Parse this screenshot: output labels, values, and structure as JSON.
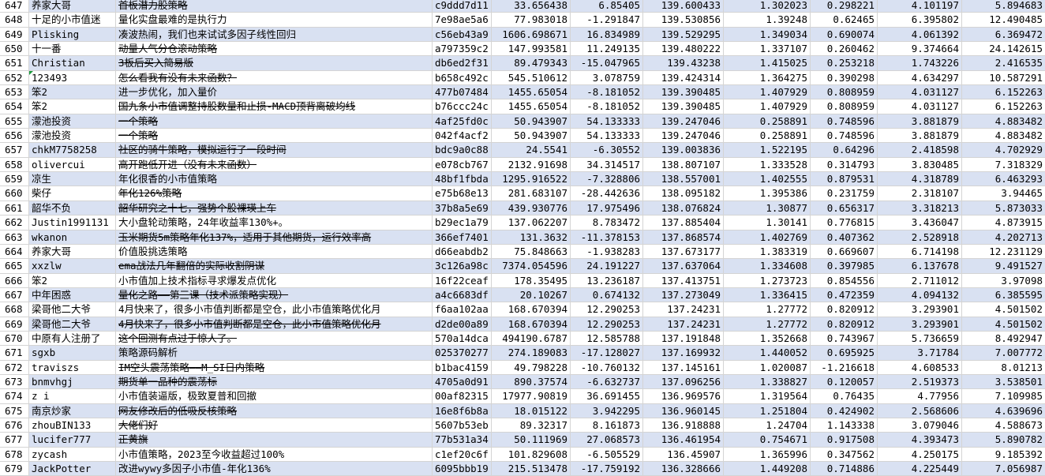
{
  "sheet": {
    "rows": [
      {
        "num": "647",
        "user": "养家大哥",
        "name": "首板潜力股策略",
        "strike": true,
        "id": "c9ddd7d11",
        "v1": "33.656438",
        "v2": "6.85405",
        "v3": "139.600433",
        "v4": "1.302023",
        "v5": "0.298221",
        "v6": "4.101197",
        "v7": "5.894683"
      },
      {
        "num": "648",
        "user": "十足的小市值迷",
        "name": "量化实盘最难的是执行力",
        "strike": false,
        "id": "7e98ae5a6",
        "v1": "77.983018",
        "v2": "-1.291847",
        "v3": "139.530856",
        "v4": "1.39248",
        "v5": "0.62465",
        "v6": "6.395802",
        "v7": "12.490485"
      },
      {
        "num": "649",
        "user": "Plisking",
        "name": "凑波热闹，我们也来试试多因子线性回归",
        "strike": false,
        "id": "c56eb43a9",
        "v1": "1606.698671",
        "v2": "16.834989",
        "v3": "139.529295",
        "v4": "1.349034",
        "v5": "0.690074",
        "v6": "4.061392",
        "v7": "6.369472"
      },
      {
        "num": "650",
        "user": "十一番",
        "name": "动量人气分仓滚动策略",
        "strike": true,
        "id": "a797359c2",
        "v1": "147.993581",
        "v2": "11.249135",
        "v3": "139.480222",
        "v4": "1.337107",
        "v5": "0.260462",
        "v6": "9.374664",
        "v7": "24.142615"
      },
      {
        "num": "651",
        "user": "Christian",
        "name": "3板后买入简易版",
        "strike": true,
        "id": "db6ed2f31",
        "v1": "89.479343",
        "v2": "-15.047965",
        "v3": "139.43238",
        "v4": "1.415025",
        "v5": "0.253218",
        "v6": "1.743226",
        "v7": "2.416535"
      },
      {
        "num": "652",
        "user": "123493",
        "name": "怎么看我有没有未来函数？",
        "strike": true,
        "id": "b658c492c",
        "v1": "545.510612",
        "v2": "3.078759",
        "v3": "139.424314",
        "v4": "1.364275",
        "v5": "0.390298",
        "v6": "4.634297",
        "v7": "10.587291",
        "flag": true
      },
      {
        "num": "653",
        "user": "笨2",
        "name": "进一步优化，加入量价",
        "strike": false,
        "id": "477b07484",
        "v1": "1455.65054",
        "v2": "-8.181052",
        "v3": "139.390485",
        "v4": "1.407929",
        "v5": "0.808959",
        "v6": "4.031127",
        "v7": "6.152263"
      },
      {
        "num": "654",
        "user": "笨2",
        "name": "国九条小市值调整持股数量和止损-MACD顶背离破均线",
        "strike": true,
        "id": "b76ccc24c",
        "v1": "1455.65054",
        "v2": "-8.181052",
        "v3": "139.390485",
        "v4": "1.407929",
        "v5": "0.808959",
        "v6": "4.031127",
        "v7": "6.152263"
      },
      {
        "num": "655",
        "user": "濛池投资",
        "name": "一个策略",
        "strike": true,
        "id": "4af25fd0c",
        "v1": "50.943907",
        "v2": "54.133333",
        "v3": "139.247046",
        "v4": "0.258891",
        "v5": "0.748596",
        "v6": "3.881879",
        "v7": "4.883482"
      },
      {
        "num": "656",
        "user": "濛池投资",
        "name": "一个策略",
        "strike": true,
        "id": "042f4acf2",
        "v1": "50.943907",
        "v2": "54.133333",
        "v3": "139.247046",
        "v4": "0.258891",
        "v5": "0.748596",
        "v6": "3.881879",
        "v7": "4.883482"
      },
      {
        "num": "657",
        "user": "chkM7758258",
        "name": "社区的骑牛策略，模拟运行了一段时间",
        "strike": true,
        "id": "bdc9a0c88",
        "v1": "24.5541",
        "v2": "-6.30552",
        "v3": "139.003836",
        "v4": "1.522195",
        "v5": "0.64296",
        "v6": "2.418598",
        "v7": "4.702929"
      },
      {
        "num": "658",
        "user": "olivercui",
        "name": "高开跑低开进（没有未来函数）",
        "strike": true,
        "id": "e078cb767",
        "v1": "2132.91698",
        "v2": "34.314517",
        "v3": "138.807107",
        "v4": "1.333528",
        "v5": "0.314793",
        "v6": "3.830485",
        "v7": "7.318329"
      },
      {
        "num": "659",
        "user": "凉生",
        "name": "年化很香的小市值策略",
        "strike": false,
        "id": "48bf1fbda",
        "v1": "1295.916522",
        "v2": "-7.328806",
        "v3": "138.557001",
        "v4": "1.402555",
        "v5": "0.879531",
        "v6": "4.318789",
        "v7": "6.463293"
      },
      {
        "num": "660",
        "user": "柴仔",
        "name": "年化126%策略",
        "strike": true,
        "id": "e75b68e13",
        "v1": "281.683107",
        "v2": "-28.442636",
        "v3": "138.095182",
        "v4": "1.395386",
        "v5": "0.231759",
        "v6": "2.318107",
        "v7": "3.94465"
      },
      {
        "num": "661",
        "user": "韶华不负",
        "name": "韶华研究之十七，强势个股裸瑛上车",
        "strike": true,
        "id": "37b8a5e69",
        "v1": "439.930776",
        "v2": "17.975496",
        "v3": "138.076824",
        "v4": "1.30877",
        "v5": "0.656317",
        "v6": "3.318213",
        "v7": "5.873033"
      },
      {
        "num": "662",
        "user": "Justin1991131",
        "name": "大小盘轮动策略，24年收益率130%+。",
        "strike": false,
        "id": "b29ec1a79",
        "v1": "137.062207",
        "v2": "8.783472",
        "v3": "137.885404",
        "v4": "1.30141",
        "v5": "0.776815",
        "v6": "3.436047",
        "v7": "4.873915"
      },
      {
        "num": "663",
        "user": "wkanon",
        "name": "玉米期货5m策略年化137%，适用于其他期货，运行效率高",
        "strike": true,
        "id": "366ef7401",
        "v1": "131.3632",
        "v2": "-11.378153",
        "v3": "137.868574",
        "v4": "1.402769",
        "v5": "0.407362",
        "v6": "2.528918",
        "v7": "4.202713"
      },
      {
        "num": "664",
        "user": "养家大哥",
        "name": "价值股挑选策略",
        "strike": false,
        "id": "d66eabdb2",
        "v1": "75.848663",
        "v2": "-1.938283",
        "v3": "137.673177",
        "v4": "1.383319",
        "v5": "0.669607",
        "v6": "6.714198",
        "v7": "12.231129"
      },
      {
        "num": "665",
        "user": "xxzlw",
        "name": "ema战法几年翻倍的实际收割阴谋",
        "strike": true,
        "id": "3c126a98c",
        "v1": "7374.054596",
        "v2": "24.191227",
        "v3": "137.637064",
        "v4": "1.334608",
        "v5": "0.397985",
        "v6": "6.137678",
        "v7": "9.491527"
      },
      {
        "num": "666",
        "user": "笨2",
        "name": "小市值加上技术指标寻求爆发点优化",
        "strike": false,
        "id": "16f22ceaf",
        "v1": "178.35495",
        "v2": "13.236187",
        "v3": "137.413751",
        "v4": "1.273723",
        "v5": "0.854556",
        "v6": "2.711012",
        "v7": "3.97098"
      },
      {
        "num": "667",
        "user": "中年困惑",
        "name": "量化之路——第三课（技术派策略实现）",
        "strike": true,
        "id": "a4c6683df",
        "v1": "20.10267",
        "v2": "0.674132",
        "v3": "137.273049",
        "v4": "1.336415",
        "v5": "0.472359",
        "v6": "4.094132",
        "v7": "6.385595"
      },
      {
        "num": "668",
        "user": "梁哥他二大爷",
        "name": "4月快来了，很多小市值判断都是空仓，此小市值策略优化月",
        "strike": false,
        "id": "f6aa102aa",
        "v1": "168.670394",
        "v2": "12.290253",
        "v3": "137.24231",
        "v4": "1.27772",
        "v5": "0.820912",
        "v6": "3.293901",
        "v7": "4.501502"
      },
      {
        "num": "669",
        "user": "梁哥他二大爷",
        "name": "4月快来了，很多小市值判断都是空仓，此小市值策略优化月",
        "strike": true,
        "id": "d2de00a89",
        "v1": "168.670394",
        "v2": "12.290253",
        "v3": "137.24231",
        "v4": "1.27772",
        "v5": "0.820912",
        "v6": "3.293901",
        "v7": "4.501502"
      },
      {
        "num": "670",
        "user": "中原有人注册了",
        "name": "这个回测有点过于惊人了。",
        "strike": true,
        "id": "570a14dca",
        "v1": "494190.6787",
        "v2": "12.585788",
        "v3": "137.191848",
        "v4": "1.352668",
        "v5": "0.743967",
        "v6": "5.736659",
        "v7": "8.492947"
      },
      {
        "num": "671",
        "user": "sgxb",
        "name": "策略源码解析",
        "strike": false,
        "id": "025370277",
        "v1": "274.189083",
        "v2": "-17.128027",
        "v3": "137.169932",
        "v4": "1.440052",
        "v5": "0.695925",
        "v6": "3.71784",
        "v7": "7.007772"
      },
      {
        "num": "672",
        "user": "traviszs",
        "name": "IM空头震荡策略——M_SI日内策略",
        "strike": true,
        "id": "b1bac4159",
        "v1": "49.798228",
        "v2": "-10.760132",
        "v3": "137.145161",
        "v4": "1.020087",
        "v5": "-1.216618",
        "v6": "4.608533",
        "v7": "8.01213"
      },
      {
        "num": "673",
        "user": "bnmvhgj",
        "name": "期货单一品种的震荡标",
        "strike": true,
        "id": "4705a0d91",
        "v1": "890.37574",
        "v2": "-6.632737",
        "v3": "137.096256",
        "v4": "1.338827",
        "v5": "0.120057",
        "v6": "2.519373",
        "v7": "3.538501"
      },
      {
        "num": "674",
        "user": "z i",
        "name": "小市值装逼版，极致夏普和回撤",
        "strike": false,
        "id": "00af82315",
        "v1": "17977.90819",
        "v2": "36.691455",
        "v3": "136.969576",
        "v4": "1.319564",
        "v5": "0.76435",
        "v6": "4.77956",
        "v7": "7.109985"
      },
      {
        "num": "675",
        "user": "南京炒家",
        "name": "网友修改后的低吸反核策略",
        "strike": true,
        "id": "16e8f6b8a",
        "v1": "18.015122",
        "v2": "3.942295",
        "v3": "136.960145",
        "v4": "1.251804",
        "v5": "0.424902",
        "v6": "2.568606",
        "v7": "4.639696"
      },
      {
        "num": "676",
        "user": "zhouBIN133",
        "name": "大佬们好",
        "strike": true,
        "id": "5607b53eb",
        "v1": "89.32317",
        "v2": "8.161873",
        "v3": "136.918888",
        "v4": "1.24704",
        "v5": "1.143338",
        "v6": "3.079046",
        "v7": "4.588673"
      },
      {
        "num": "677",
        "user": "lucifer777",
        "name": "正黄旗",
        "strike": true,
        "id": "77b531a34",
        "v1": "50.111969",
        "v2": "27.068573",
        "v3": "136.461954",
        "v4": "0.754671",
        "v5": "0.917508",
        "v6": "4.393473",
        "v7": "5.890782"
      },
      {
        "num": "678",
        "user": "zycash",
        "name": "小市值策略，2023至今收益超过100%",
        "strike": false,
        "id": "c1ef20c6f",
        "v1": "101.829608",
        "v2": "-6.505529",
        "v3": "136.45907",
        "v4": "1.365996",
        "v5": "0.347562",
        "v6": "4.250175",
        "v7": "9.185392"
      },
      {
        "num": "679",
        "user": "JackPotter",
        "name": "改进wywy多因子小市值-年化136%",
        "strike": false,
        "id": "6095bbb19",
        "v1": "215.513478",
        "v2": "-17.759192",
        "v3": "136.328666",
        "v4": "1.449208",
        "v5": "0.714886",
        "v6": "4.225449",
        "v7": "7.056987"
      }
    ]
  }
}
